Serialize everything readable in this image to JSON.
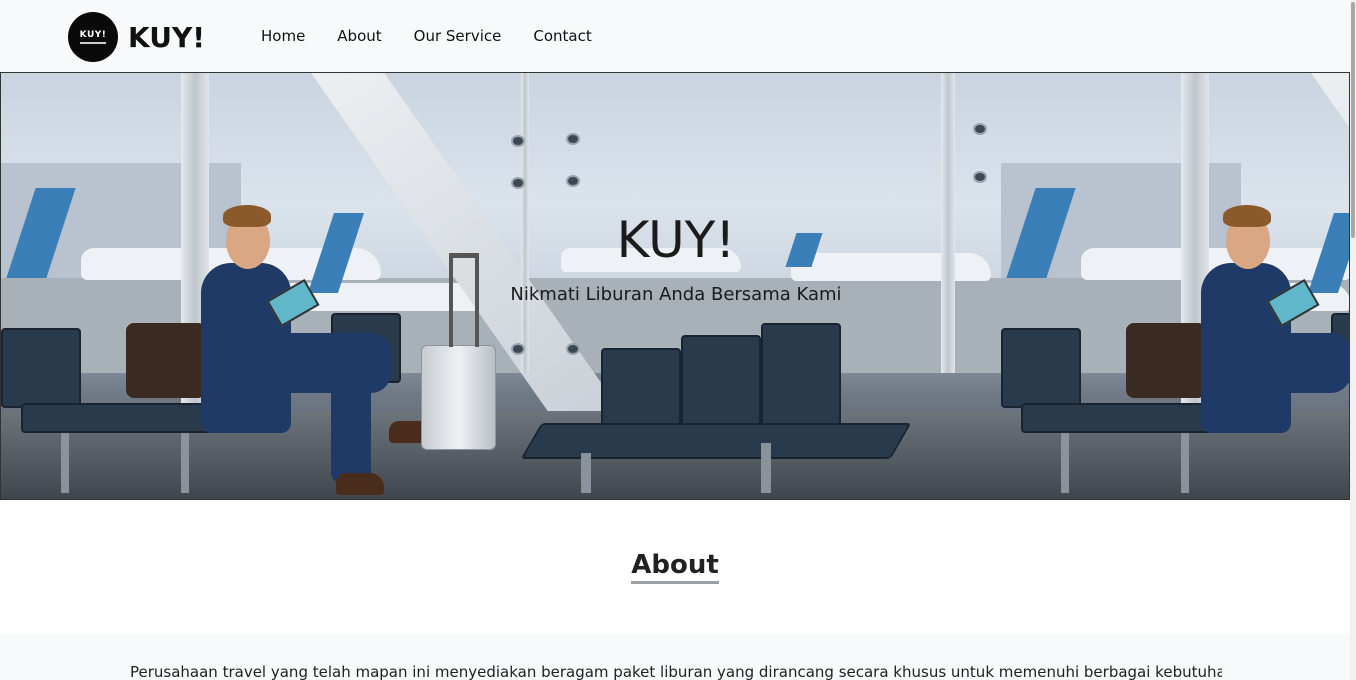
{
  "navbar": {
    "brand": "KUY!",
    "logo_text": "KUY!",
    "items": [
      {
        "label": "Home"
      },
      {
        "label": "About"
      },
      {
        "label": "Our Service"
      },
      {
        "label": "Contact"
      }
    ]
  },
  "hero": {
    "title": "KUY!",
    "subtitle": "Nikmati Liburan Anda Bersama Kami"
  },
  "about": {
    "heading": "About",
    "text": "Perusahaan travel yang telah mapan ini menyediakan beragam paket liburan yang dirancang secara khusus untuk memenuhi berbagai kebutuhan dan"
  },
  "colors": {
    "navbar_bg": "#f8f9fa",
    "section_bg": "#f8f9fa",
    "text": "#212529"
  }
}
